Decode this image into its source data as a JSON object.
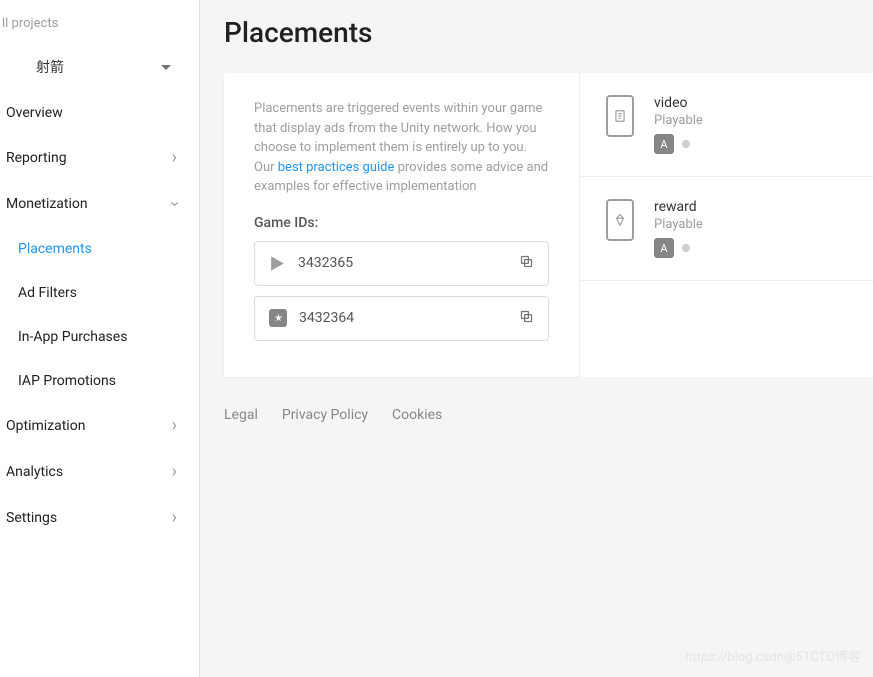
{
  "sidebar": {
    "all_projects": "ll projects",
    "project_name": "射箭",
    "items": {
      "overview": "Overview",
      "reporting": "Reporting",
      "monetization": "Monetization",
      "optimization": "Optimization",
      "analytics": "Analytics",
      "settings": "Settings"
    },
    "sub_items": {
      "placements": "Placements",
      "ad_filters": "Ad Filters",
      "in_app_purchases": "In-App Purchases",
      "iap_promotions": "IAP Promotions"
    }
  },
  "page": {
    "title": "Placements",
    "description_1": "Placements are triggered events within your game that display ads from the Unity network. How you choose to implement them is entirely up to you. Our ",
    "link_text": "best practices guide",
    "description_2": " provides some advice and examples for effective implementation",
    "game_ids_label": "Game IDs:",
    "ids": [
      {
        "platform": "google-play",
        "value": "3432365"
      },
      {
        "platform": "apple",
        "value": "3432364"
      }
    ]
  },
  "placements": [
    {
      "name": "video",
      "subtitle": "Playable",
      "icon": "document"
    },
    {
      "name": "reward",
      "subtitle": "Playable",
      "icon": "diamond"
    }
  ],
  "footer": {
    "legal": "Legal",
    "privacy": "Privacy Policy",
    "cookies": "Cookies"
  },
  "watermark": "https://blog.csdn@51CTO博客"
}
